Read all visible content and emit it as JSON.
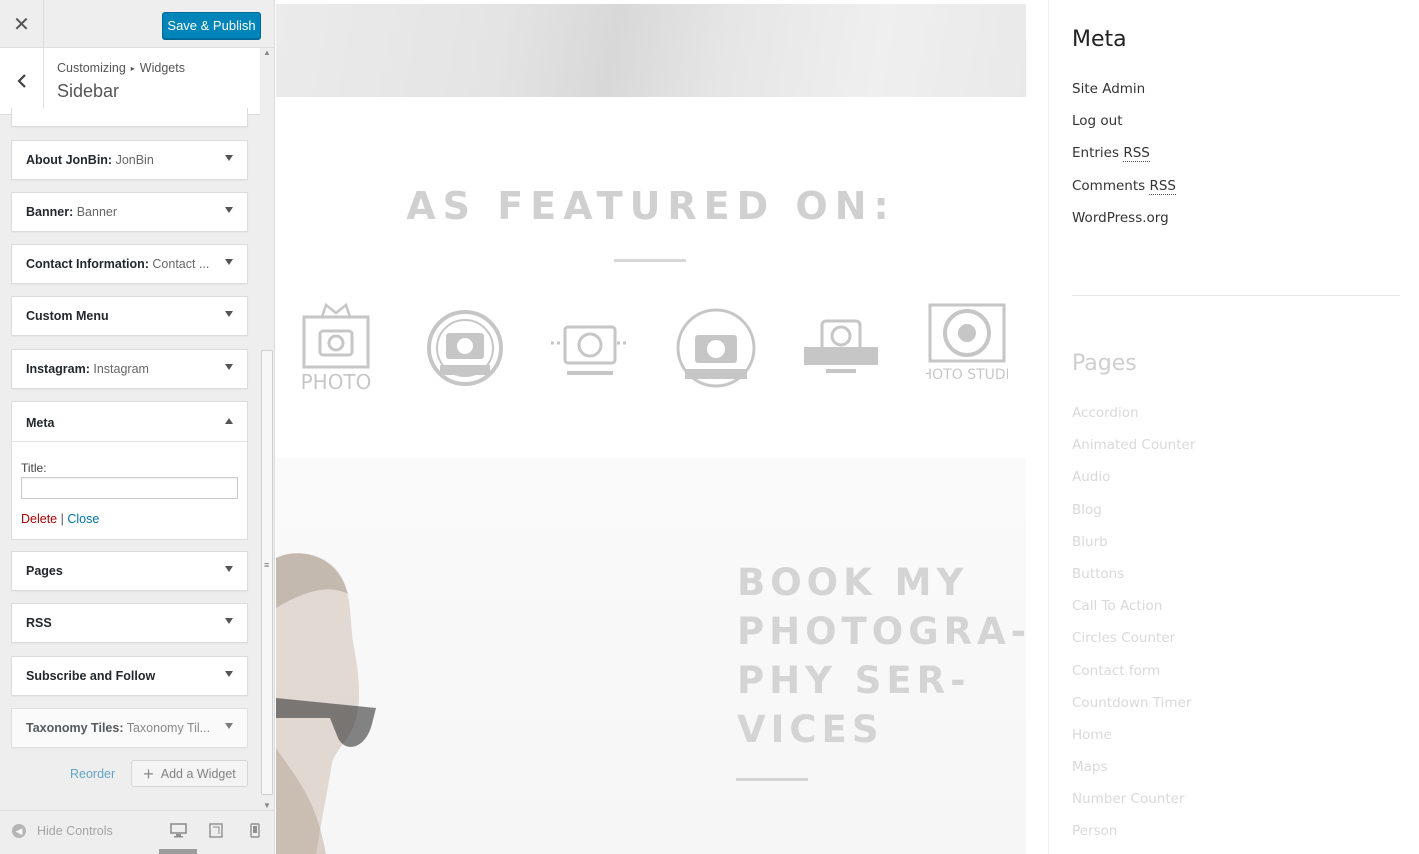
{
  "customizer": {
    "header": {
      "close_label": "✕",
      "publish_label": "Save & Publish"
    },
    "breadcrumb": {
      "root": "Customizing",
      "separator": "▸",
      "parent": "Widgets"
    },
    "section_title": "Sidebar",
    "widgets_before": [
      {
        "name": "About JonBin:",
        "subtitle": " JonBin"
      },
      {
        "name": "Banner:",
        "subtitle": " Banner"
      },
      {
        "name": "Contact Information:",
        "subtitle": " Contact ..."
      },
      {
        "name": "Custom Menu",
        "subtitle": ""
      },
      {
        "name": "Instagram:",
        "subtitle": " Instagram"
      }
    ],
    "meta_widget": {
      "name": "Meta",
      "title_label": "Title:",
      "title_value": "",
      "delete_label": "Delete",
      "separator": " | ",
      "close_label": "Close"
    },
    "widgets_after": [
      {
        "name": "Pages",
        "subtitle": ""
      },
      {
        "name": "RSS",
        "subtitle": ""
      },
      {
        "name": "Subscribe and Follow",
        "subtitle": ""
      },
      {
        "name": "Taxonomy Tiles:",
        "subtitle": " Taxonomy Til..."
      }
    ],
    "reorder_label": "Reorder",
    "add_widget_label": "Add a Widget",
    "footer": {
      "hide_controls_label": "Hide Controls",
      "devices": [
        "desktop-icon",
        "tablet-icon",
        "mobile-icon"
      ],
      "active_device": "desktop"
    }
  },
  "preview": {
    "featured_heading": "AS FEATURED ON:",
    "logo_captions": [
      "PHOTO",
      "PHOTO STUDIO"
    ],
    "book_heading": "BOOK MY\nPHOTOGRA-\nPHY SER-\nVICES",
    "sidebar": {
      "meta": {
        "title": "Meta",
        "items": [
          "Site Admin",
          "Log out",
          "Entries",
          "Comments",
          "WordPress.org"
        ],
        "rss_abbr": "RSS"
      },
      "pages": {
        "title": "Pages",
        "items": [
          "Accordion",
          "Animated Counter",
          "Audio",
          "Blog",
          "Blurb",
          "Buttons",
          "Call To Action",
          "Circles Counter",
          "Contact form",
          "Countdown Timer",
          "Home",
          "Maps",
          "Number Counter",
          "Person"
        ]
      }
    }
  },
  "colors": {
    "primary_button": "#0085ba",
    "link": "#0073aa",
    "delete_link": "#aa0000",
    "panel_bg": "#eeeeee"
  }
}
